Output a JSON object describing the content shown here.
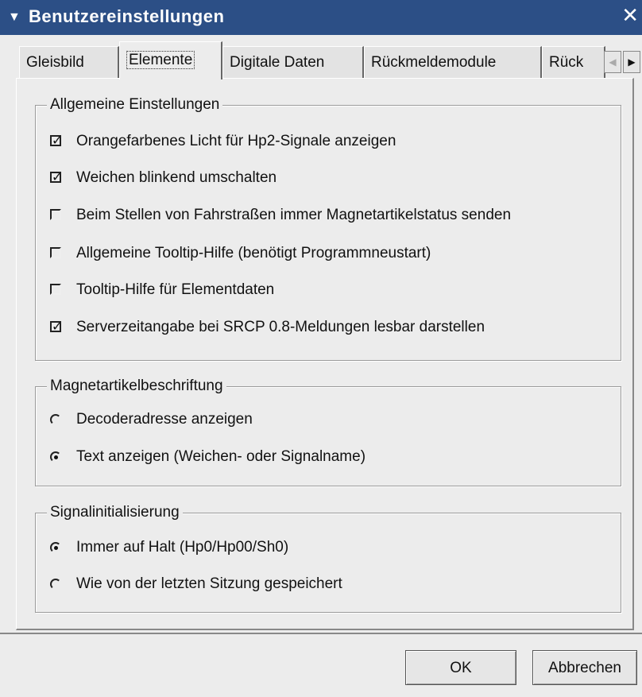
{
  "window": {
    "title": "Benutzereinstellungen",
    "title_arrow": "▼",
    "close_glyph": "✕"
  },
  "tabs": [
    {
      "label": "Gleisbild",
      "active": false
    },
    {
      "label": "Elemente",
      "active": true
    },
    {
      "label": "Digitale Daten",
      "active": false
    },
    {
      "label": "Rückmeldemodule",
      "active": false
    },
    {
      "label": "Rück",
      "active": false
    }
  ],
  "tab_scroll": {
    "left_icon": "chevron-left",
    "right_icon": "chevron-right",
    "left_glyph": "◀",
    "right_glyph": "▶"
  },
  "groups": {
    "general": {
      "title": "Allgemeine Einstellungen",
      "options": [
        {
          "label": "Orangefarbenes Licht für Hp2-Signale anzeigen",
          "checked": true
        },
        {
          "label": "Weichen blinkend umschalten",
          "checked": true
        },
        {
          "label": "Beim Stellen von Fahrstraßen immer Magnetartikelstatus senden",
          "checked": false
        },
        {
          "label": "Allgemeine Tooltip-Hilfe (benötigt Programmneustart)",
          "checked": false
        },
        {
          "label": "Tooltip-Hilfe für Elementdaten",
          "checked": false
        },
        {
          "label": "Serverzeitangabe bei SRCP 0.8-Meldungen lesbar darstellen",
          "checked": true
        }
      ]
    },
    "labeling": {
      "title": "Magnetartikelbeschriftung",
      "options": [
        {
          "label": "Decoderadresse anzeigen",
          "selected": false
        },
        {
          "label": "Text anzeigen (Weichen- oder Signalname)",
          "selected": true
        }
      ]
    },
    "signal_init": {
      "title": "Signalinitialisierung",
      "options": [
        {
          "label": "Immer auf Halt (Hp0/Hp00/Sh0)",
          "selected": true
        },
        {
          "label": "Wie von der letzten Sitzung gespeichert",
          "selected": false
        }
      ]
    }
  },
  "buttons": {
    "ok": "OK",
    "cancel": "Abbrechen"
  },
  "check_glyph": "✓"
}
